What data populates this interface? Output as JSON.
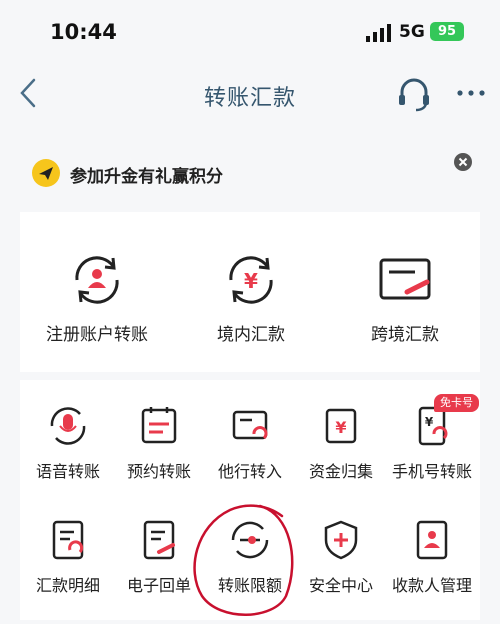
{
  "status": {
    "time": "10:44",
    "network": "5G",
    "battery": "95"
  },
  "nav": {
    "title": "转账汇款"
  },
  "promo": {
    "text": "参加升金有礼赢积分"
  },
  "main_services": [
    {
      "label": "注册账户转账",
      "icon": "registered-account-transfer-icon"
    },
    {
      "label": "境内汇款",
      "icon": "domestic-remittance-icon"
    },
    {
      "label": "跨境汇款",
      "icon": "cross-border-remittance-icon"
    }
  ],
  "services": [
    {
      "label": "语音转账",
      "icon": "voice-transfer-icon"
    },
    {
      "label": "预约转账",
      "icon": "scheduled-transfer-icon"
    },
    {
      "label": "他行转入",
      "icon": "other-bank-transfer-in-icon"
    },
    {
      "label": "资金归集",
      "icon": "fund-collection-icon"
    },
    {
      "label": "手机号转账",
      "icon": "phone-number-transfer-icon",
      "badge": "免卡号"
    },
    {
      "label": "汇款明细",
      "icon": "remittance-details-icon"
    },
    {
      "label": "电子回单",
      "icon": "e-receipt-icon"
    },
    {
      "label": "转账限额",
      "icon": "transfer-limit-icon"
    },
    {
      "label": "安全中心",
      "icon": "security-center-icon"
    },
    {
      "label": "收款人管理",
      "icon": "payee-management-icon"
    }
  ],
  "colors": {
    "accent": "#e83a4b",
    "title": "#35566e",
    "annotation": "#c8102e"
  }
}
